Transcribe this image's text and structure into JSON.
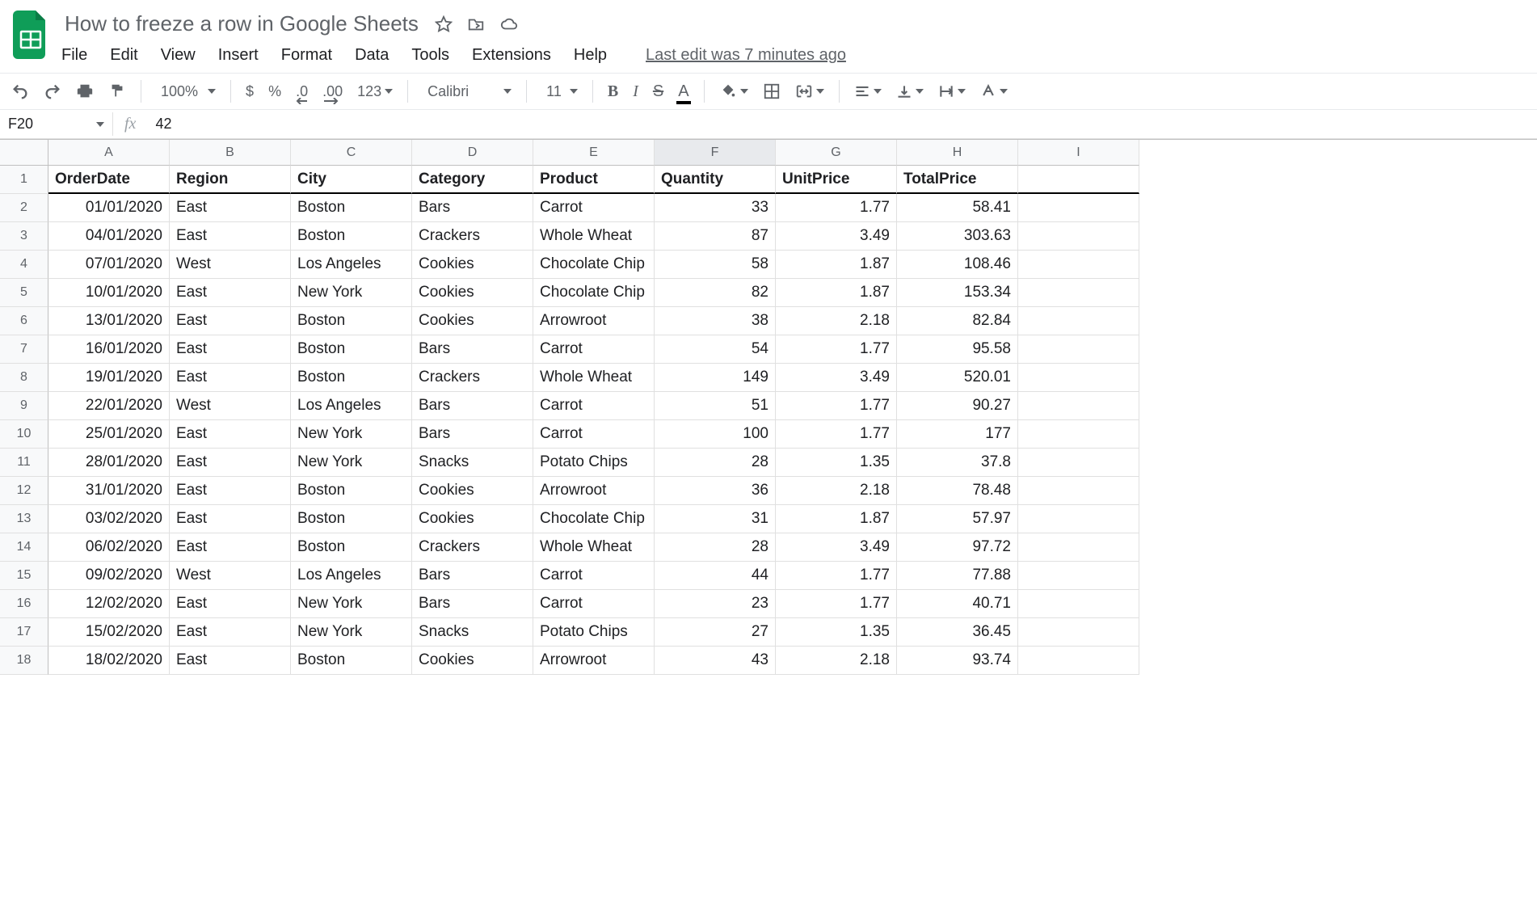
{
  "doc": {
    "title": "How to freeze a row in Google Sheets",
    "last_edit": "Last edit was 7 minutes ago"
  },
  "menubar": [
    "File",
    "Edit",
    "View",
    "Insert",
    "Format",
    "Data",
    "Tools",
    "Extensions",
    "Help"
  ],
  "toolbar": {
    "zoom": "100%",
    "currency": "$",
    "percent": "%",
    "dec_dec": ".0",
    "inc_dec": ".00",
    "more_formats": "123",
    "font_face": "Calibri",
    "font_size": "11",
    "bold": "B",
    "italic": "I",
    "strike": "S",
    "text_color": "A"
  },
  "namebox": {
    "ref": "F20",
    "fx": "fx",
    "value": "42"
  },
  "columns": [
    "A",
    "B",
    "C",
    "D",
    "E",
    "F",
    "G",
    "H",
    "I"
  ],
  "active_col": "F",
  "headers": [
    "OrderDate",
    "Region",
    "City",
    "Category",
    "Product",
    "Quantity",
    "UnitPrice",
    "TotalPrice"
  ],
  "rows": [
    [
      "01/01/2020",
      "East",
      "Boston",
      "Bars",
      "Carrot",
      "33",
      "1.77",
      "58.41"
    ],
    [
      "04/01/2020",
      "East",
      "Boston",
      "Crackers",
      "Whole Wheat",
      "87",
      "3.49",
      "303.63"
    ],
    [
      "07/01/2020",
      "West",
      "Los Angeles",
      "Cookies",
      "Chocolate Chip",
      "58",
      "1.87",
      "108.46"
    ],
    [
      "10/01/2020",
      "East",
      "New York",
      "Cookies",
      "Chocolate Chip",
      "82",
      "1.87",
      "153.34"
    ],
    [
      "13/01/2020",
      "East",
      "Boston",
      "Cookies",
      "Arrowroot",
      "38",
      "2.18",
      "82.84"
    ],
    [
      "16/01/2020",
      "East",
      "Boston",
      "Bars",
      "Carrot",
      "54",
      "1.77",
      "95.58"
    ],
    [
      "19/01/2020",
      "East",
      "Boston",
      "Crackers",
      "Whole Wheat",
      "149",
      "3.49",
      "520.01"
    ],
    [
      "22/01/2020",
      "West",
      "Los Angeles",
      "Bars",
      "Carrot",
      "51",
      "1.77",
      "90.27"
    ],
    [
      "25/01/2020",
      "East",
      "New York",
      "Bars",
      "Carrot",
      "100",
      "1.77",
      "177"
    ],
    [
      "28/01/2020",
      "East",
      "New York",
      "Snacks",
      "Potato Chips",
      "28",
      "1.35",
      "37.8"
    ],
    [
      "31/01/2020",
      "East",
      "Boston",
      "Cookies",
      "Arrowroot",
      "36",
      "2.18",
      "78.48"
    ],
    [
      "03/02/2020",
      "East",
      "Boston",
      "Cookies",
      "Chocolate Chip",
      "31",
      "1.87",
      "57.97"
    ],
    [
      "06/02/2020",
      "East",
      "Boston",
      "Crackers",
      "Whole Wheat",
      "28",
      "3.49",
      "97.72"
    ],
    [
      "09/02/2020",
      "West",
      "Los Angeles",
      "Bars",
      "Carrot",
      "44",
      "1.77",
      "77.88"
    ],
    [
      "12/02/2020",
      "East",
      "New York",
      "Bars",
      "Carrot",
      "23",
      "1.77",
      "40.71"
    ],
    [
      "15/02/2020",
      "East",
      "New York",
      "Snacks",
      "Potato Chips",
      "27",
      "1.35",
      "36.45"
    ],
    [
      "18/02/2020",
      "East",
      "Boston",
      "Cookies",
      "Arrowroot",
      "43",
      "2.18",
      "93.74"
    ]
  ]
}
